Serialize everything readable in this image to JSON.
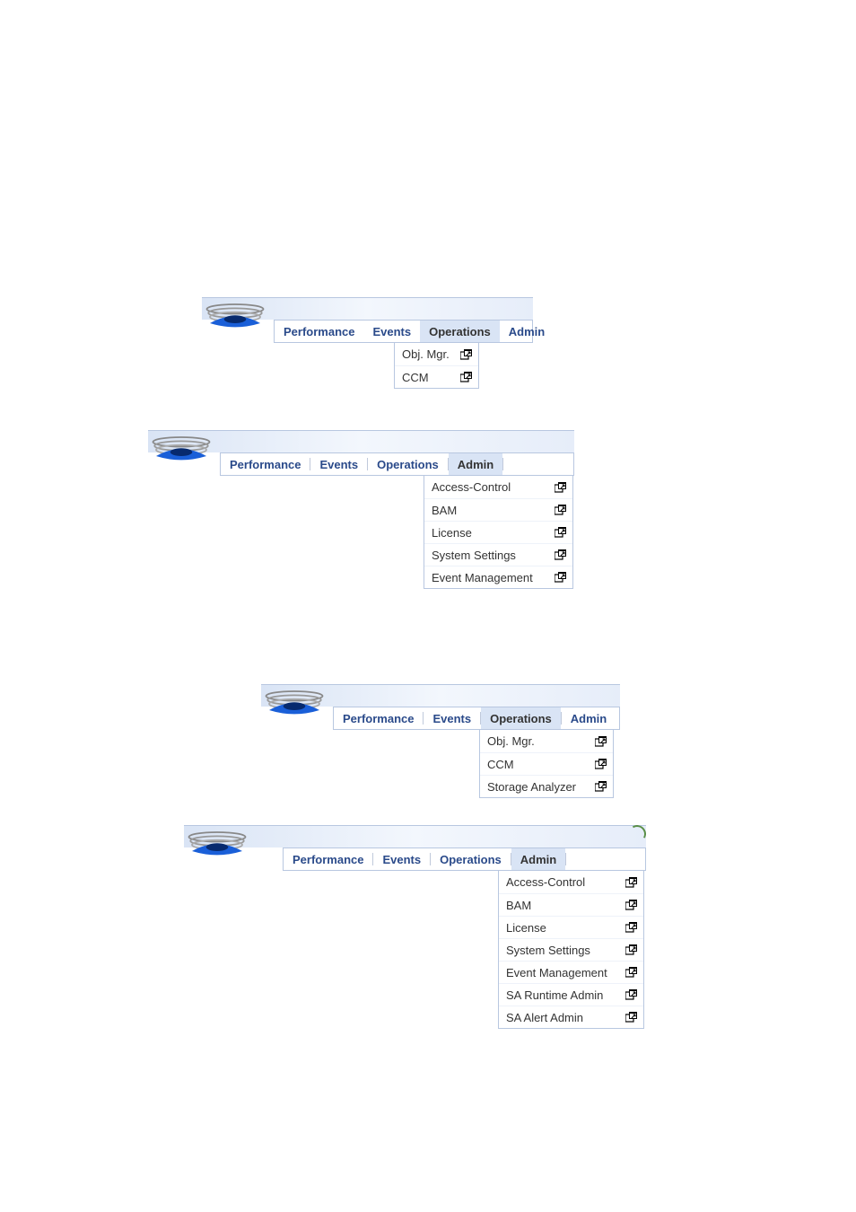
{
  "tabs": {
    "performance": "Performance",
    "events": "Events",
    "operations": "Operations",
    "admin": "Admin"
  },
  "panel1": {
    "selected": "operations",
    "dropdown": [
      "Obj. Mgr.",
      "CCM"
    ]
  },
  "panel2": {
    "selected": "admin",
    "dropdown": [
      "Access-Control",
      "BAM",
      "License",
      "System Settings",
      "Event Management"
    ]
  },
  "panel3": {
    "selected": "operations",
    "dropdown": [
      "Obj. Mgr.",
      "CCM",
      "Storage Analyzer"
    ]
  },
  "panel4": {
    "selected": "admin",
    "dropdown": [
      "Access-Control",
      "BAM",
      "License",
      "System Settings",
      "Event Management",
      "SA Runtime Admin",
      "SA Alert Admin"
    ]
  }
}
